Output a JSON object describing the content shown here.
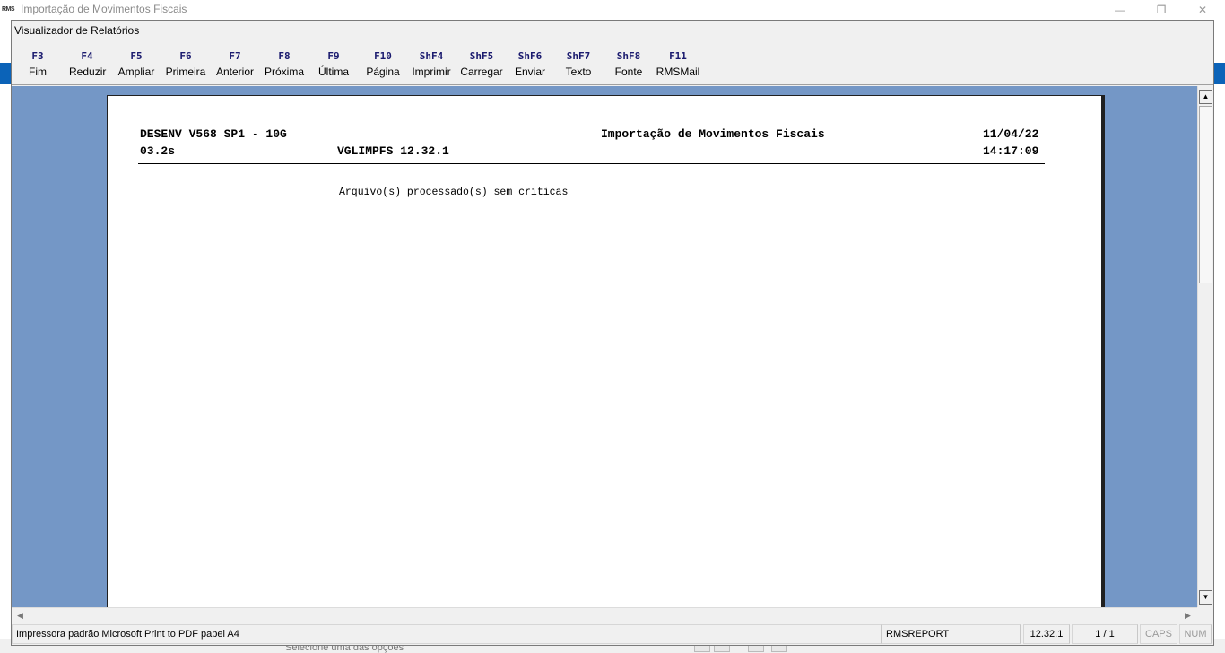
{
  "outer_window": {
    "logo": "RMS",
    "title": "Importação de Movimentos Fiscais",
    "minimize_icon": "minimize-icon",
    "maximize_icon": "maximize-icon",
    "close_icon": "close-icon",
    "min_glyph": "—",
    "max_glyph": "❐",
    "close_glyph": "✕",
    "bottom_text": "Selecione uma das opções"
  },
  "viewer": {
    "title": "Visualizador de Relatórios",
    "toolbar": [
      {
        "key": "F3",
        "label": "Fim"
      },
      {
        "key": "F4",
        "label": "Reduzir"
      },
      {
        "key": "F5",
        "label": "Ampliar"
      },
      {
        "key": "F6",
        "label": "Primeira"
      },
      {
        "key": "F7",
        "label": "Anterior"
      },
      {
        "key": "F8",
        "label": "Próxima"
      },
      {
        "key": "F9",
        "label": "Última"
      },
      {
        "key": "F10",
        "label": "Página"
      },
      {
        "key": "ShF4",
        "label": "Imprimir"
      },
      {
        "key": "ShF5",
        "label": "Carregar"
      },
      {
        "key": "ShF6",
        "label": "Enviar"
      },
      {
        "key": "ShF7",
        "label": "Texto"
      },
      {
        "key": "ShF8",
        "label": "Fonte"
      },
      {
        "key": "F11",
        "label": "RMSMail"
      }
    ]
  },
  "report": {
    "environment": "DESENV V568 SP1 - 10G",
    "title": "Importação de Movimentos Fiscais",
    "date": "11/04/22",
    "elapsed": "03.2s",
    "program": "VGLIMPFS 12.32.1",
    "time": "14:17:09",
    "message": "Arquivo(s) processado(s) sem criticas"
  },
  "scrollbars": {
    "up_arrow": "▲",
    "down_arrow": "▼",
    "left_arrow": "◀",
    "right_arrow": "▶"
  },
  "status_bar": {
    "printer": "Impressora padrão Microsoft Print to PDF papel A4",
    "module": "RMSREPORT",
    "version": "12.32.1",
    "page": "1 / 1",
    "caps": "CAPS",
    "num": "NUM"
  },
  "colors": {
    "report_background": "#7497c6",
    "accent_blue": "#0b63b8",
    "toolbar_key": "#1a1a6e"
  }
}
